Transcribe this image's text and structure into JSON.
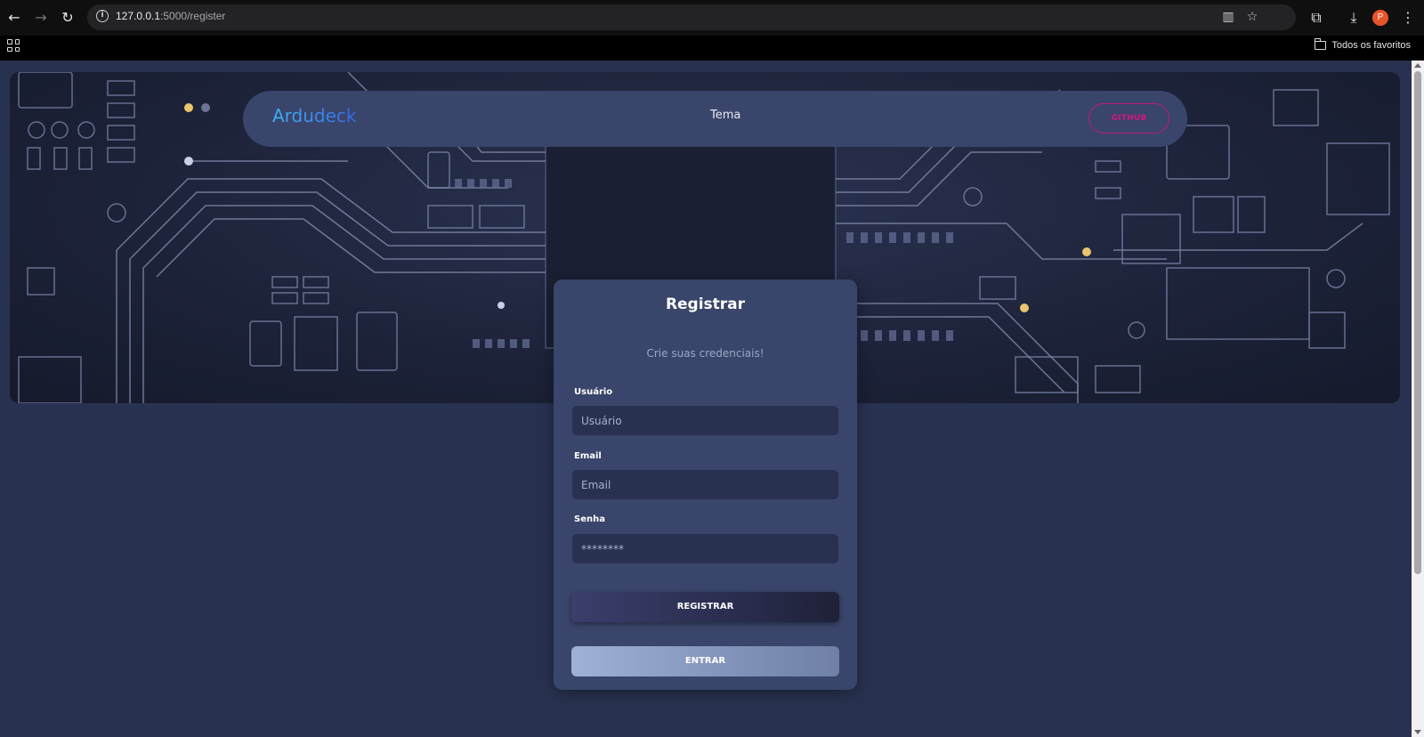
{
  "browser": {
    "url_host": "127.0.0.1",
    "url_path": ":5000/register",
    "bookmarks_label": "Todos os favoritos",
    "profile_initial": "P",
    "icons": [
      "back-icon",
      "forward-icon",
      "reload-icon",
      "site-info-icon",
      "translate-icon",
      "star-icon",
      "extensions-icon",
      "download-icon",
      "menu-dots-icon",
      "apps-icon",
      "folder-icon"
    ]
  },
  "header": {
    "brand": "Ardudeck",
    "nav_link": "Tema",
    "github_label": "GITHUB"
  },
  "register": {
    "title": "Registrar",
    "subtitle": "Crie suas credenciais!",
    "username_label": "Usuário",
    "username_placeholder": "Usuário",
    "email_label": "Email",
    "email_placeholder": "Email",
    "password_label": "Senha",
    "password_placeholder": "********",
    "register_button": "REGISTRAR",
    "login_button": "ENTRAR"
  },
  "colors": {
    "page_bg": "#283250",
    "card_bg": "#39456a",
    "brand_gradient_start": "#3fb0f5",
    "brand_gradient_end": "#3768e6",
    "github_accent": "#d4157f"
  }
}
